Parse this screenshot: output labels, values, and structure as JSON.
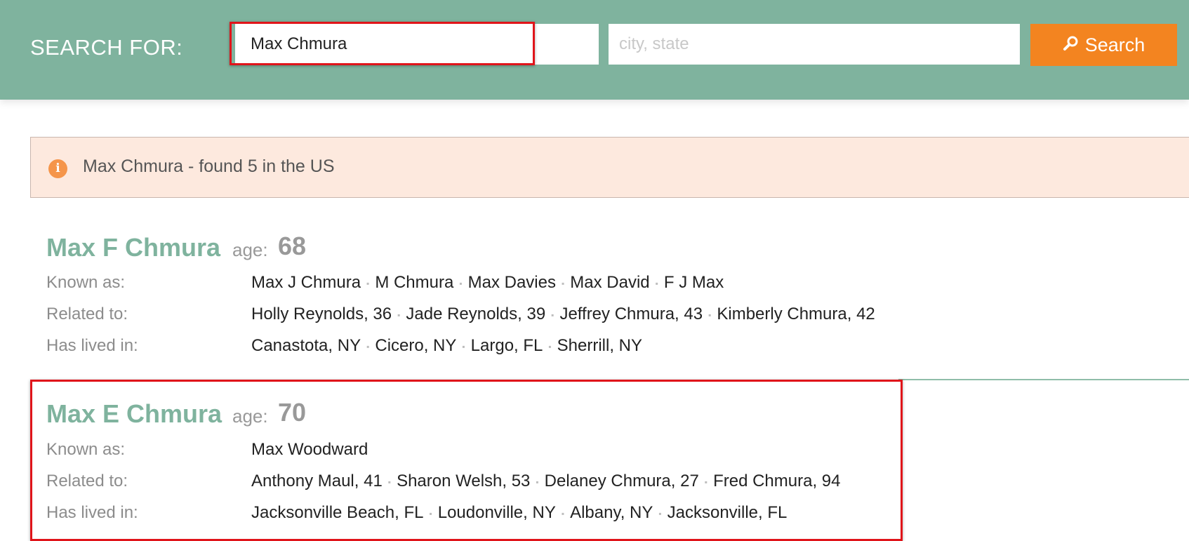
{
  "header": {
    "search_label": "SEARCH FOR:",
    "name_value": "Max Chmura",
    "location_placeholder": "city, state",
    "search_button": "Search",
    "background_color": "#7fb39e",
    "button_color": "#f38420"
  },
  "info": {
    "message": "Max Chmura - found 5 in the US",
    "icon": "info-icon"
  },
  "labels": {
    "age": "age:",
    "known_as": "Known as:",
    "related_to": "Related to:",
    "has_lived_in": "Has lived in:"
  },
  "results": [
    {
      "name": "Max F Chmura",
      "age": "68",
      "known_as": [
        "Max J Chmura",
        "M Chmura",
        "Max Davies",
        "Max David",
        "F J Max"
      ],
      "related_to": [
        "Holly Reynolds, 36",
        "Jade Reynolds, 39",
        "Jeffrey Chmura, 43",
        "Kimberly Chmura, 42"
      ],
      "has_lived_in": [
        "Canastota, NY",
        "Cicero, NY",
        "Largo, FL",
        "Sherrill, NY"
      ]
    },
    {
      "name": "Max E Chmura",
      "age": "70",
      "known_as": [
        "Max Woodward"
      ],
      "related_to": [
        "Anthony Maul, 41",
        "Sharon Welsh, 53",
        "Delaney Chmura, 27",
        "Fred Chmura, 94"
      ],
      "has_lived_in": [
        "Jacksonville Beach, FL",
        "Loudonville, NY",
        "Albany, NY",
        "Jacksonville, FL"
      ]
    }
  ]
}
